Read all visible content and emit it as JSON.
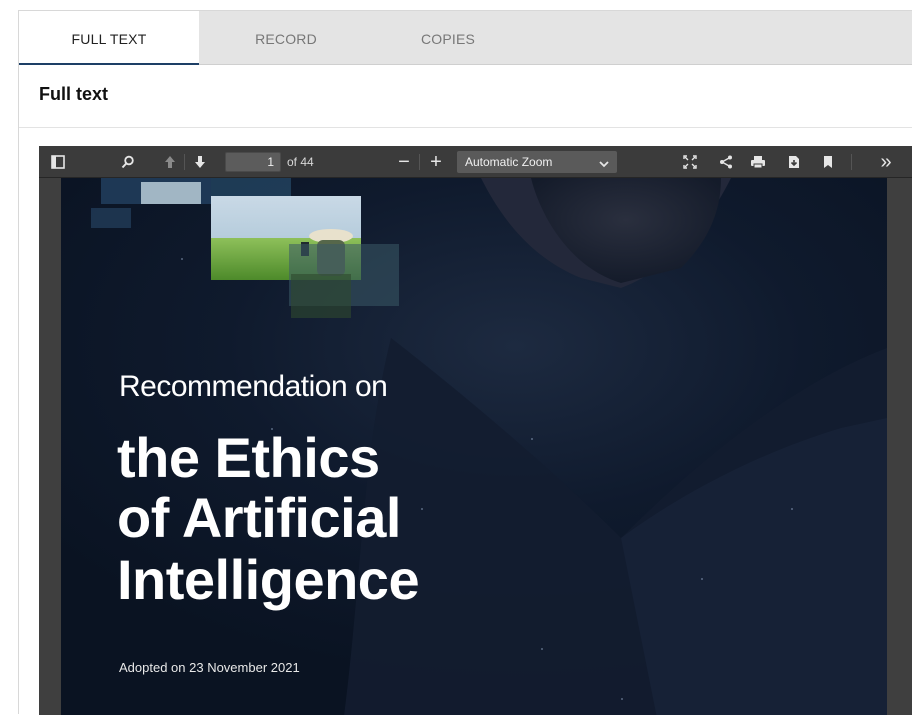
{
  "tabs": [
    {
      "label": "FULL TEXT",
      "active": true
    },
    {
      "label": "RECORD",
      "active": false
    },
    {
      "label": "COPIES",
      "active": false
    }
  ],
  "section": {
    "title": "Full text"
  },
  "viewer": {
    "toolbar": {
      "icons": [
        "sidebar-toggle-icon",
        "search-icon",
        "previous-page-icon",
        "next-page-icon",
        "zoom-out-icon",
        "zoom-in-icon",
        "presentation-mode-icon",
        "share-icon",
        "print-icon",
        "download-icon",
        "bookmark-icon",
        "tools-menu-icon"
      ],
      "page_number": "1",
      "page_count": "of 44",
      "zoom_out": "−",
      "zoom_in": "+",
      "zoom_value": "Automatic Zoom",
      "more": "»"
    },
    "document": {
      "subtitle": "Recommendation on",
      "title_lines": [
        "the Ethics",
        "of Artificial",
        "Intelligence"
      ],
      "date": "Adopted on 23 November 2021"
    }
  },
  "colors": {
    "accent": "#1d3f66",
    "toolbar_bg": "#3b3b3b",
    "cover_bg": "#0f1a2d"
  }
}
